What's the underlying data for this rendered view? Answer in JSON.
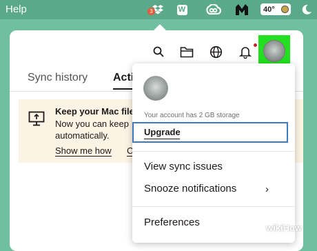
{
  "menubar": {
    "help_label": "Help",
    "dropbox_badge": "3",
    "wp_icon_letter": "W",
    "weather_temp": "40°"
  },
  "toolbar": {
    "icons": [
      "search-icon",
      "folder-icon",
      "globe-icon",
      "bell-icon"
    ]
  },
  "tabs": {
    "sync_history": "Sync history",
    "active_partial": "Acti"
  },
  "banner": {
    "title": "Keep your Mac file",
    "body": "Now you can keep automatically.",
    "show_me_how": "Show me how",
    "second_link_partial": "C"
  },
  "dropdown": {
    "storage_text": "Your account has 2 GB storage",
    "upgrade_label": "Upgrade",
    "view_sync_issues": "View sync issues",
    "snooze_notifications": "Snooze notifications",
    "snooze_chevron": "›",
    "preferences": "Preferences"
  },
  "watermark": "wikiHow",
  "colors": {
    "background": "#6fbfa0",
    "highlight_green": "#22e020",
    "upgrade_outline_blue": "#3c78c6",
    "banner_bg": "#fbf3e3",
    "notification_dot": "#c2232a"
  }
}
